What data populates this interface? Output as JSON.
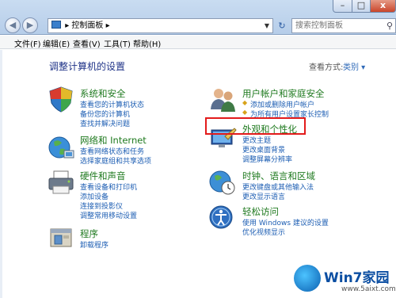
{
  "window": {
    "address": "控制面板",
    "search_placeholder": "搜索控制面板",
    "min_glyph": "–",
    "max_glyph": "□",
    "close_glyph": "x"
  },
  "menu": [
    "文件(F)",
    "编辑(E)",
    "查看(V)",
    "工具(T)",
    "帮助(H)"
  ],
  "page": {
    "title": "调整计算机的设置",
    "view_by_label": "查看方式:",
    "view_by_value": "类别 ▾"
  },
  "categories": {
    "system": {
      "title": "系统和安全",
      "links": [
        "查看您的计算机状态",
        "备份您的计算机",
        "查找并解决问题"
      ]
    },
    "network": {
      "title": "网络和 Internet",
      "links": [
        "查看网络状态和任务",
        "选择家庭组和共享选项"
      ]
    },
    "hardware": {
      "title": "硬件和声音",
      "links": [
        "查看设备和打印机",
        "添加设备",
        "连接到投影仪",
        "调整常用移动设置"
      ]
    },
    "programs": {
      "title": "程序",
      "links": [
        "卸载程序"
      ]
    },
    "users": {
      "title": "用户帐户和家庭安全",
      "links": [
        "添加或删除用户帐户",
        "为所有用户设置家长控制"
      ]
    },
    "appearance": {
      "title": "外观和个性化",
      "links": [
        "更改主题",
        "更改桌面背景",
        "调整屏幕分辨率"
      ]
    },
    "clock": {
      "title": "时钟、语言和区域",
      "links": [
        "更改键盘或其他输入法",
        "更改显示语言"
      ]
    },
    "ease": {
      "title": "轻松访问",
      "links": [
        "使用 Windows 建议的设置",
        "优化视频显示"
      ]
    }
  },
  "watermark": {
    "brand": "Win7家园",
    "url": "www.5aixt.com"
  },
  "colors": {
    "category_title": "#1f7a1f",
    "link": "#1d5eb3",
    "highlight": "#e31b1b"
  }
}
